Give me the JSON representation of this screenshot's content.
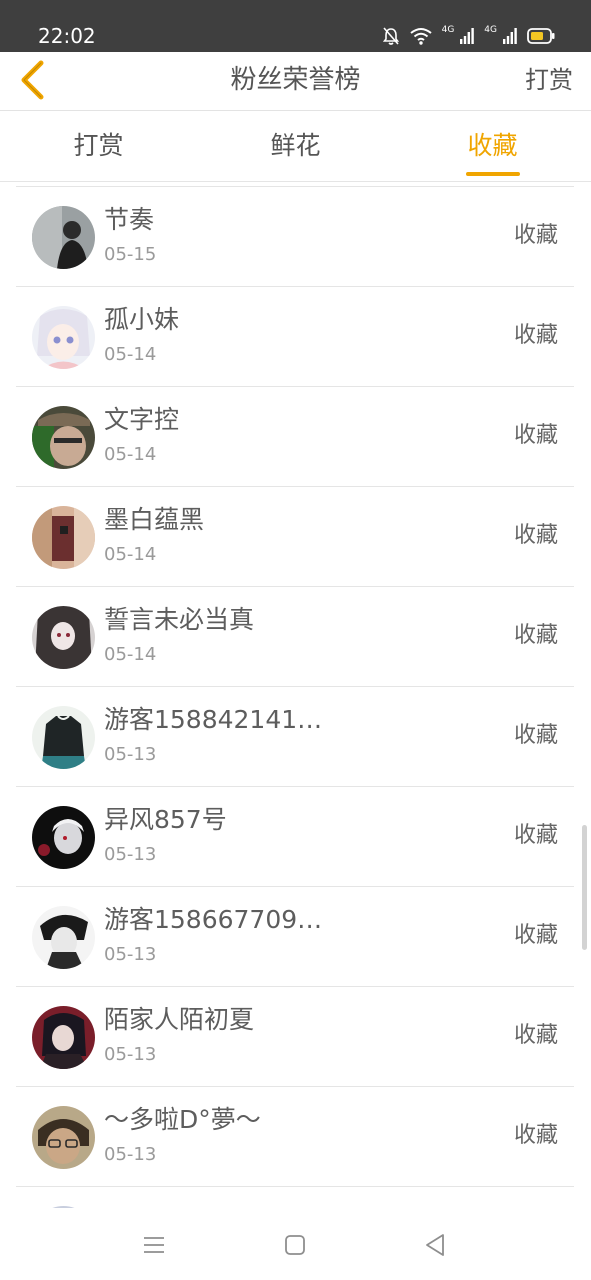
{
  "status_bar": {
    "time": "22:02",
    "network_1": "4G",
    "network_2": "4G",
    "icons": [
      "mute-icon",
      "wifi-icon",
      "signal-icon",
      "signal-icon",
      "battery-icon"
    ]
  },
  "header": {
    "title": "粉丝荣誉榜",
    "action_label": "打赏",
    "back_icon": "chevron-left-icon",
    "accent_color": "#f0a500"
  },
  "tabs": [
    {
      "label": "打赏",
      "active": false
    },
    {
      "label": "鲜花",
      "active": false
    },
    {
      "label": "收藏",
      "active": true
    }
  ],
  "fans": [
    {
      "name": "节奏",
      "date": "05-15",
      "action": "收藏"
    },
    {
      "name": "孤小妹",
      "date": "05-14",
      "action": "收藏"
    },
    {
      "name": "文字控",
      "date": "05-14",
      "action": "收藏"
    },
    {
      "name": "墨白蕴黑",
      "date": "05-14",
      "action": "收藏"
    },
    {
      "name": "誓言未必当真",
      "date": "05-14",
      "action": "收藏"
    },
    {
      "name": "游客1588421413...",
      "date": "05-13",
      "action": "收藏"
    },
    {
      "name": "异风857号",
      "date": "05-13",
      "action": "收藏"
    },
    {
      "name": "游客1586677097...",
      "date": "05-13",
      "action": "收藏"
    },
    {
      "name": "陌家人陌初夏",
      "date": "05-13",
      "action": "收藏"
    },
    {
      "name": "～多啦D°夢～",
      "date": "05-13",
      "action": "收藏"
    }
  ],
  "nav_bar": {
    "icons": [
      "menu-icon",
      "home-square-icon",
      "back-triangle-icon"
    ]
  }
}
